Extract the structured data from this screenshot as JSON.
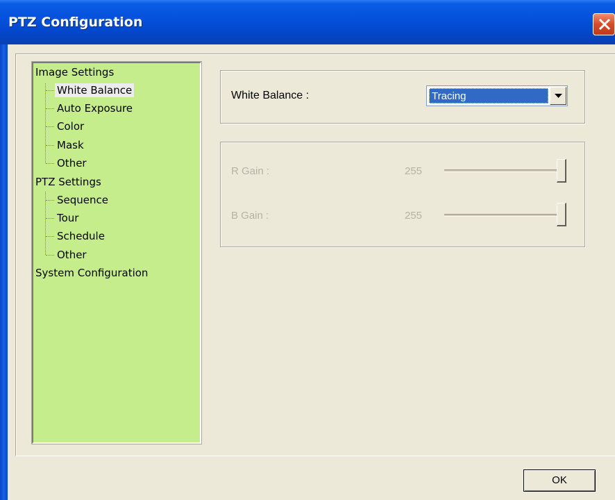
{
  "window": {
    "title": "PTZ Configuration"
  },
  "tree": {
    "groups": [
      {
        "label": "Image Settings",
        "children": [
          "White Balance",
          "Auto Exposure",
          "Color",
          "Mask",
          "Other"
        ]
      },
      {
        "label": "PTZ Settings",
        "children": [
          "Sequence",
          "Tour",
          "Schedule",
          "Other"
        ]
      },
      {
        "label": "System Configuration",
        "children": []
      }
    ],
    "selected": "White Balance"
  },
  "white_balance": {
    "label": "White Balance :",
    "value": "Tracing"
  },
  "gains": {
    "r_label": "R Gain :",
    "r_value": "255",
    "r_level": 1.0,
    "b_label": "B Gain :",
    "b_value": "255",
    "b_level": 1.0
  },
  "footer": {
    "ok_label": "OK"
  },
  "colors": {
    "tree_background": "#c6ed8c",
    "selection": "#316ac5",
    "titlebar": "#0552dd"
  }
}
